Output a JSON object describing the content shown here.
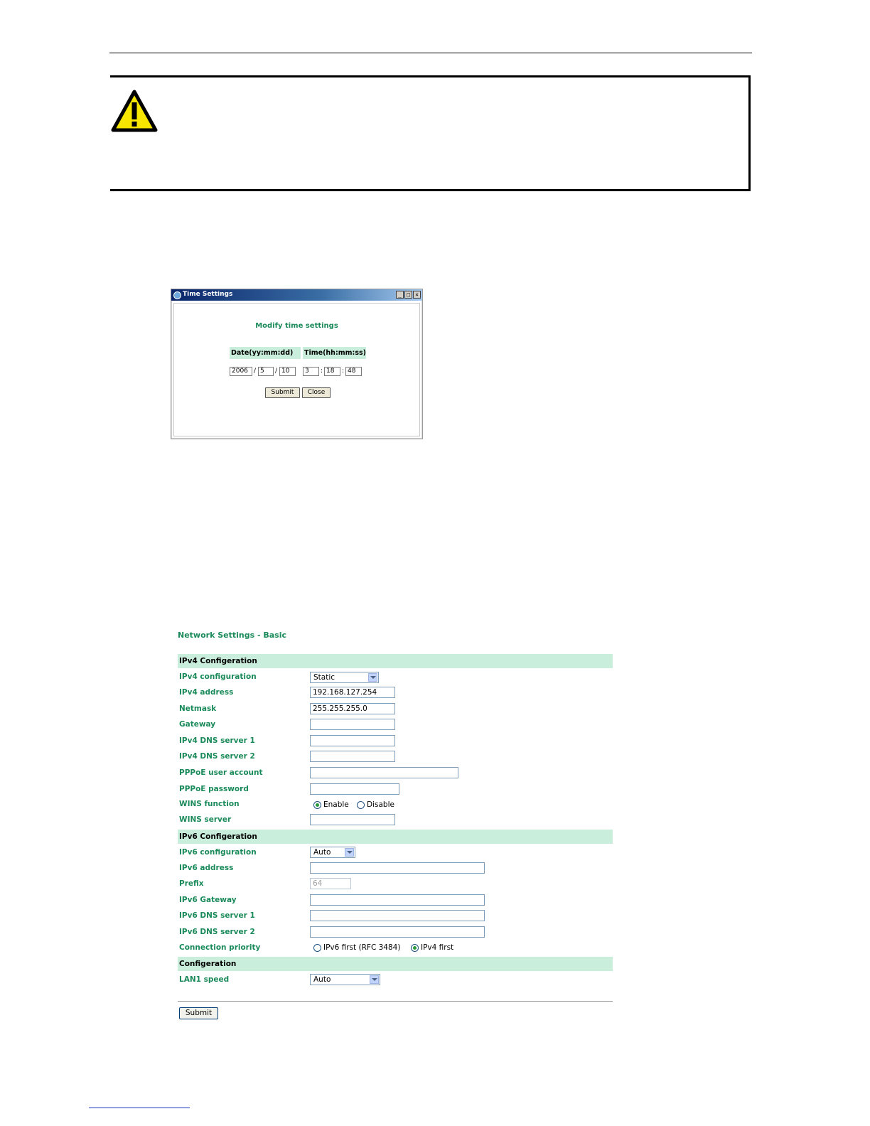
{
  "time_settings": {
    "window_title": "Time Settings",
    "heading": "Modify time settings",
    "date_header": "Date(yy:mm:dd)",
    "time_header": "Time(hh:mm:ss)",
    "year": "2006",
    "month": "5",
    "day": "10",
    "hour": "3",
    "minute": "18",
    "second": "48",
    "date_sep": "/",
    "time_sep": ":",
    "submit_label": "Submit",
    "close_label": "Close",
    "window_buttons": [
      "_",
      "□",
      "×"
    ]
  },
  "network": {
    "title": "Network Settings - Basic",
    "ipv4_section": "IPv4 Configeration",
    "ipv4_rows": {
      "ipv4_configuration": {
        "label": "IPv4 configuration",
        "value": "Static"
      },
      "ipv4_address": {
        "label": "IPv4 address",
        "value": "192.168.127.254"
      },
      "netmask": {
        "label": "Netmask",
        "value": "255.255.255.0"
      },
      "gateway": {
        "label": "Gateway",
        "value": ""
      },
      "dns1": {
        "label": "IPv4 DNS server 1",
        "value": ""
      },
      "dns2": {
        "label": "IPv4 DNS server 2",
        "value": ""
      },
      "pppoe_user": {
        "label": "PPPoE user account",
        "value": ""
      },
      "pppoe_pass": {
        "label": "PPPoE password",
        "value": ""
      },
      "wins_function": {
        "label": "WINS function",
        "options": [
          "Enable",
          "Disable"
        ],
        "selected": "Enable"
      },
      "wins_server": {
        "label": "WINS server",
        "value": ""
      }
    },
    "ipv6_section": "IPv6 Configeration",
    "ipv6_rows": {
      "ipv6_configuration": {
        "label": "IPv6 configuration",
        "value": "Auto"
      },
      "ipv6_address": {
        "label": "IPv6 address",
        "value": ""
      },
      "prefix": {
        "label": "Prefix",
        "value": "64"
      },
      "ipv6_gateway": {
        "label": "IPv6 Gateway",
        "value": ""
      },
      "ipv6_dns1": {
        "label": "IPv6 DNS server 1",
        "value": ""
      },
      "ipv6_dns2": {
        "label": "IPv6 DNS server 2",
        "value": ""
      },
      "connection_priority": {
        "label": "Connection priority",
        "options": [
          "IPv6 first (RFC 3484)",
          "IPv4 first"
        ],
        "selected": "IPv4 first"
      }
    },
    "config_section": "Configeration",
    "lan1_speed": {
      "label": "LAN1 speed",
      "value": "Auto"
    },
    "submit_label": "Submit"
  },
  "colors": {
    "accent_green": "#1a8a5a",
    "section_bg": "#c9eedb",
    "warning_yellow": "#f7e600"
  }
}
